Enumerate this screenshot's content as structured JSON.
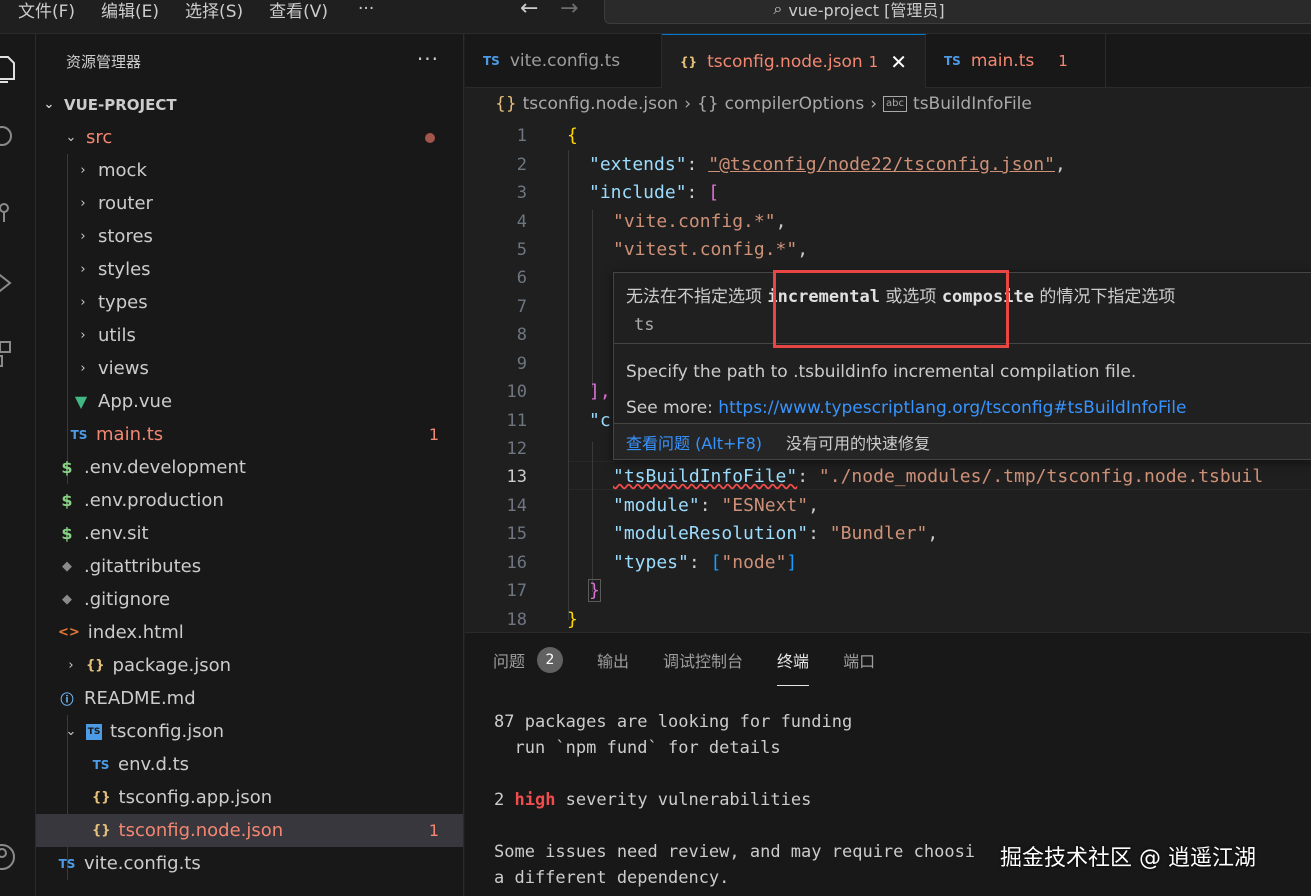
{
  "menu": [
    "文件(F)",
    "编辑(E)",
    "选择(S)",
    "查看(V)",
    "···"
  ],
  "title_search": "vue-project [管理员]",
  "sidebar": {
    "title": "资源管理器",
    "more": "···",
    "project": "VUE-PROJECT",
    "items": [
      {
        "label": "src",
        "type": "folder-open",
        "red": true,
        "dot": true
      },
      {
        "label": "mock",
        "type": "folder"
      },
      {
        "label": "router",
        "type": "folder"
      },
      {
        "label": "stores",
        "type": "folder"
      },
      {
        "label": "styles",
        "type": "folder"
      },
      {
        "label": "types",
        "type": "folder"
      },
      {
        "label": "utils",
        "type": "folder"
      },
      {
        "label": "views",
        "type": "folder"
      },
      {
        "label": "App.vue",
        "type": "vue"
      },
      {
        "label": "main.ts",
        "type": "ts",
        "red": true,
        "badge": "1"
      },
      {
        "label": ".env.development",
        "type": "env"
      },
      {
        "label": ".env.production",
        "type": "env"
      },
      {
        "label": ".env.sit",
        "type": "env"
      },
      {
        "label": ".gitattributes",
        "type": "git"
      },
      {
        "label": ".gitignore",
        "type": "git"
      },
      {
        "label": "index.html",
        "type": "html"
      },
      {
        "label": "package.json",
        "type": "json-folder"
      },
      {
        "label": "README.md",
        "type": "info"
      },
      {
        "label": "tsconfig.json",
        "type": "tsconfig-open"
      },
      {
        "label": "env.d.ts",
        "type": "ts"
      },
      {
        "label": "tsconfig.app.json",
        "type": "json"
      },
      {
        "label": "tsconfig.node.json",
        "type": "json",
        "red": true,
        "badge": "1",
        "selected": true
      },
      {
        "label": "vite.config.ts",
        "type": "ts"
      }
    ]
  },
  "tabs": [
    {
      "label": "vite.config.ts",
      "icon": "TS"
    },
    {
      "label": "tsconfig.node.json",
      "icon": "{}",
      "num": "1",
      "active": true
    },
    {
      "label": "main.ts",
      "icon": "TS",
      "num": "1"
    }
  ],
  "breadcrumb": [
    "tsconfig.node.json",
    "compilerOptions",
    "tsBuildInfoFile"
  ],
  "line_numbers": [
    "1",
    "2",
    "3",
    "4",
    "5",
    "6",
    "7",
    "8",
    "9",
    "10",
    "11",
    "12",
    "13",
    "14",
    "15",
    "16",
    "17",
    "18"
  ],
  "code": {
    "l1": "{",
    "l2_key": "\"extends\"",
    "l2_val": "\"@tsconfig/node22/tsconfig.json\"",
    "l3_key": "\"include\"",
    "l3_br": "[",
    "l4": "\"vite.config.*\"",
    "l5": "\"vitest.config.*\"",
    "l10": "],",
    "l11": "\"c",
    "l13_key": "\"tsBuildInfoFile\"",
    "l13_val": "\"./node_modules/.tmp/tsconfig.node.tsbuil",
    "l14_key": "\"module\"",
    "l14_val": "\"ESNext\"",
    "l15_key": "\"moduleResolution\"",
    "l15_val": "\"Bundler\"",
    "l16_key": "\"types\"",
    "l16_val": "\"node\"",
    "l17": "}",
    "l18": "}"
  },
  "hover": {
    "err_pre": "无法在不指定选项",
    "err_kw1": "incremental",
    "err_mid": "或选项",
    "err_kw2": "composite",
    "err_post": "的情况下指定选项",
    "err_ts": "ts",
    "desc": "Specify the path to .tsbuildinfo incremental compilation file.",
    "see_more": "See more:",
    "link": "https://www.typescriptlang.org/tsconfig#tsBuildInfoFile",
    "action_view": "查看问题 (Alt+F8)",
    "action_none": "没有可用的快速修复"
  },
  "panel": {
    "tabs": [
      "问题",
      "输出",
      "调试控制台",
      "终端",
      "端口"
    ],
    "problems_count": "2",
    "terminal": {
      "l1": "87 packages are looking for funding",
      "l2": "  run `npm fund` for details",
      "l3_pre": "2 ",
      "l3_hi": "high",
      "l3_post": " severity vulnerabilities",
      "l4": "Some issues need review, and may require choosi",
      "l5": "a different dependency."
    }
  },
  "watermark": "掘金技术社区 @ 逍遥江湖"
}
